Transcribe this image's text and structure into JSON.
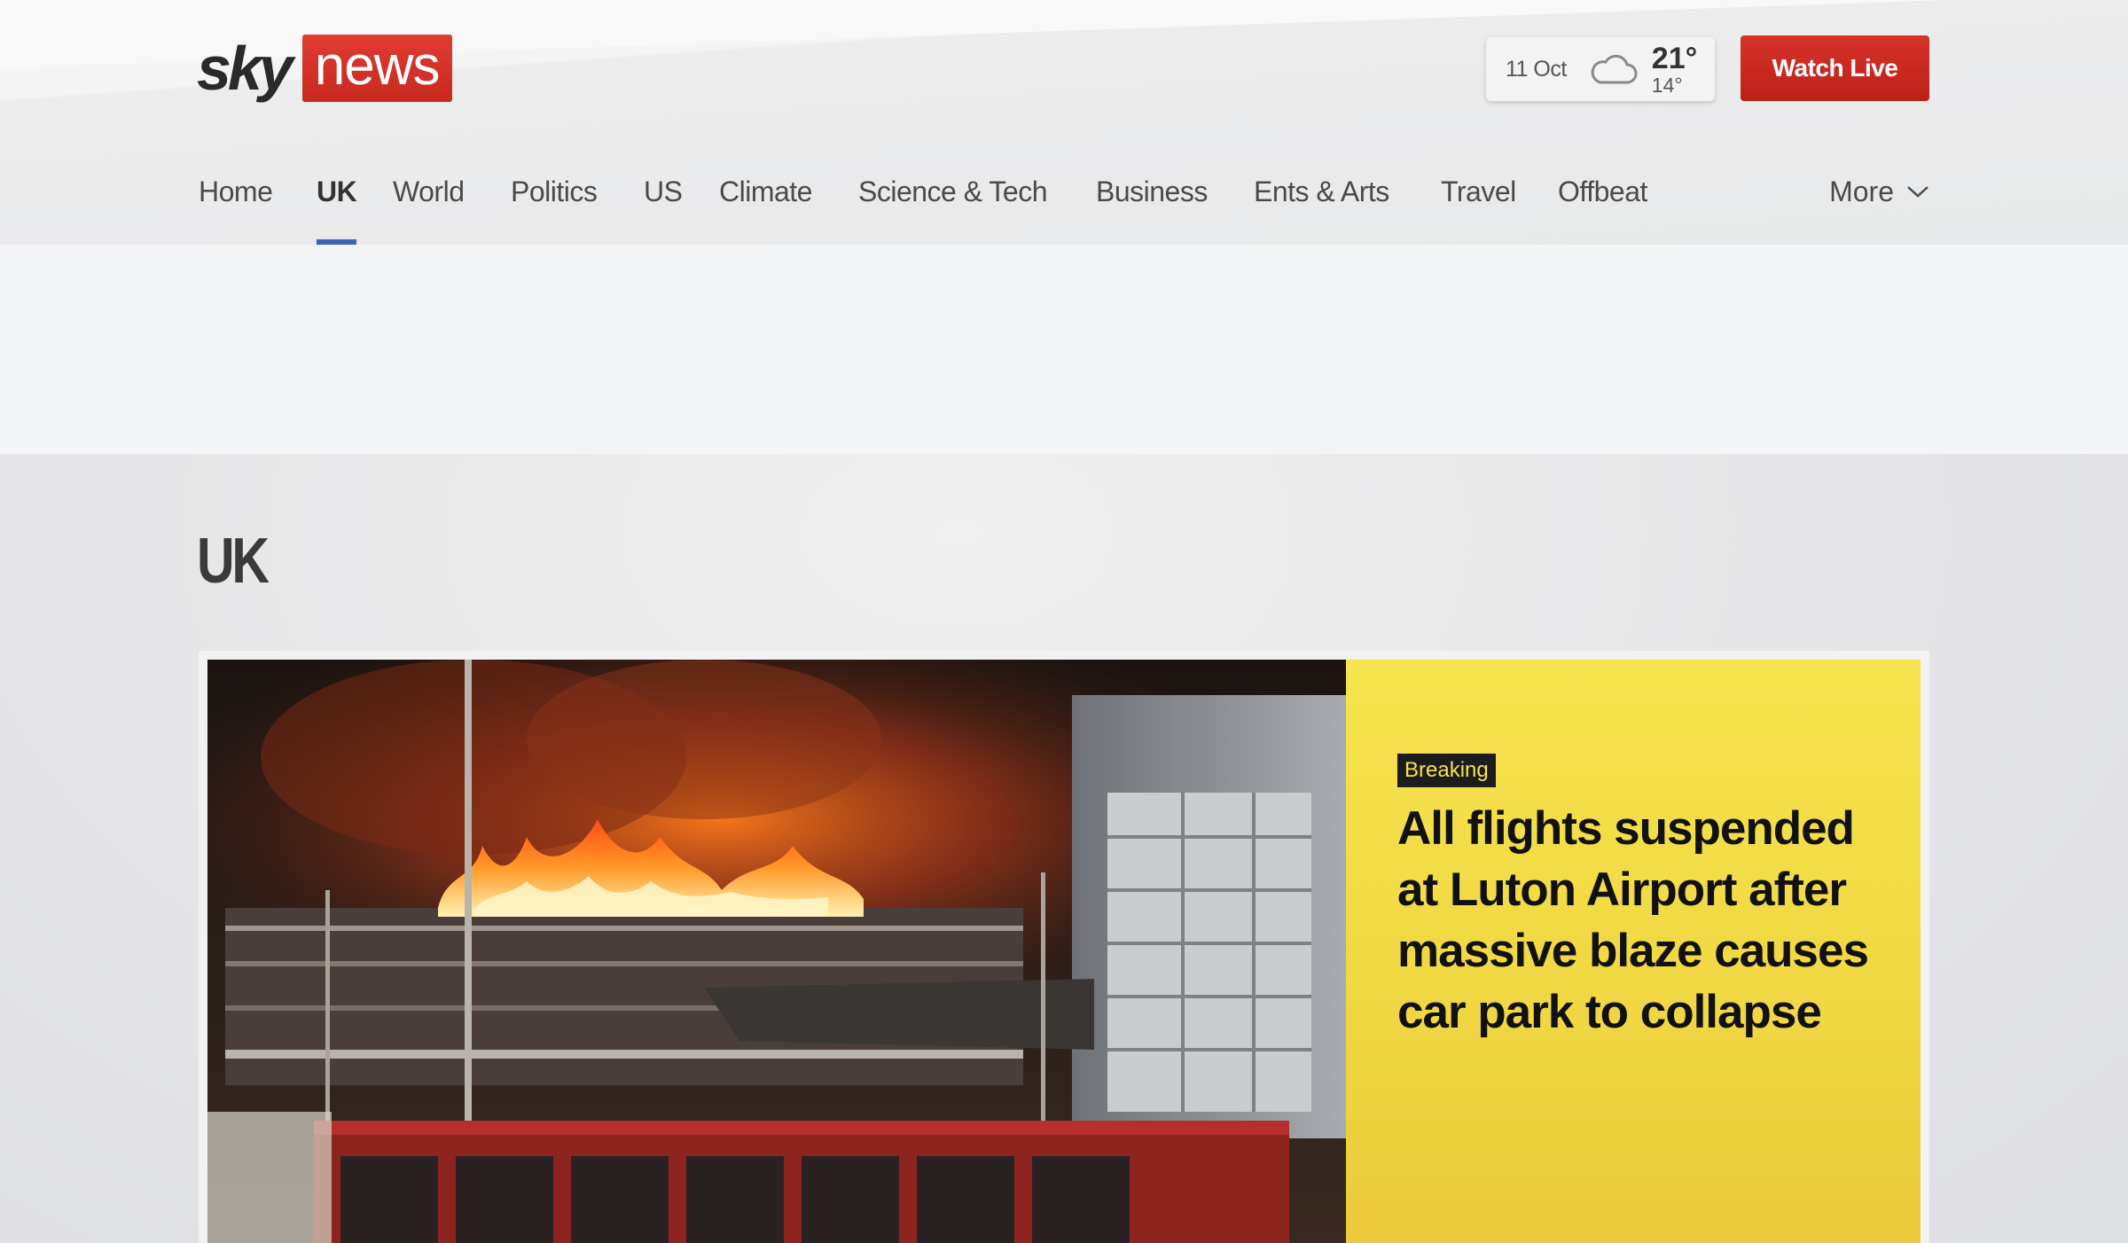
{
  "brand": {
    "sky": "sky",
    "news": "news"
  },
  "weather": {
    "date": "11 Oct",
    "high": "21°",
    "low": "14°",
    "icon": "cloud-icon"
  },
  "watch_live_label": "Watch Live",
  "nav": {
    "items": [
      "Home",
      "UK",
      "World",
      "Politics",
      "US",
      "Climate",
      "Science & Tech",
      "Business",
      "Ents & Arts",
      "Travel",
      "Offbeat"
    ],
    "active": "UK",
    "more_label": "More"
  },
  "section": {
    "title": "UK"
  },
  "lead_story": {
    "badge": "Breaking",
    "headline": "All flights suspended at Luton Airport after massive blaze causes car park to collapse"
  },
  "colors": {
    "brand_red": "#c72a20",
    "nav_active": "#3b62b6",
    "breaking_yellow": "#f5e44f"
  }
}
